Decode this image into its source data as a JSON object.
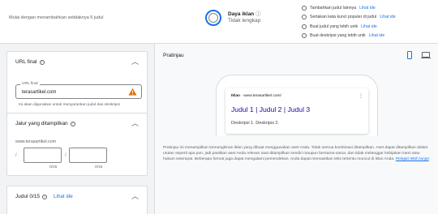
{
  "banner": {
    "tip": "Mulai dengan menambahkan setidaknya 5 judul",
    "strength_label": "Daya iklan",
    "strength_value": "Tidak lengkap",
    "checklist": [
      {
        "text": "Tambahkan judul lainnya",
        "link": "Lihat ide"
      },
      {
        "text": "Sertakan kata kunci populer di judul",
        "link": "Lihat ide"
      },
      {
        "text": "Buat judul yang lebih unik",
        "link": "Lihat ide"
      },
      {
        "text": "Buat deskripsi yang lebih unik",
        "link": "Lihat ide"
      }
    ]
  },
  "final_url": {
    "title": "URL final",
    "field_label": "URL final",
    "value": "terasartikel.com",
    "hint": "Ini akan digunakan untuk menyarankan judul dan deskripsi"
  },
  "display_path": {
    "title": "Jalur yang ditampilkan",
    "domain": "www.terasartikel.com",
    "path1_count": "0/15",
    "path2_count": "0/15"
  },
  "headlines": {
    "title": "Judul 0/15",
    "ideas_link": "Lihat ide"
  },
  "preview": {
    "title": "Pratinjau",
    "ad_label": "Iklan",
    "ad_url": "www.terasartikel.com/",
    "headline": "Judul 1 | Judul 2 | Judul 3",
    "description": "Deskripsi 1. Deskripsi 2.",
    "disclaimer": "Pratinjau ini menampilkan kemungkinan iklan yang dibuat menggunakan aset Anda. Tidak semua kombinasi ditampilkan. Aset dapat ditampilkan dalam urutan seperti apa pun, jadi pastikan aset Anda relevan saat ditampilkan sendiri maupun bersama-sama, dan tidak melanggar kebijakan kami atau hukum setempat. Beberapa format juga dapat mengalami pemendekan. Anda dapat memastikan teks tertentu muncul di iklan Anda.",
    "learn_more": "Pelajari lebih lanjut"
  },
  "colors": {
    "accent": "#1a73e8",
    "warning": "#e37400",
    "ad_headline": "#1a0dab"
  }
}
